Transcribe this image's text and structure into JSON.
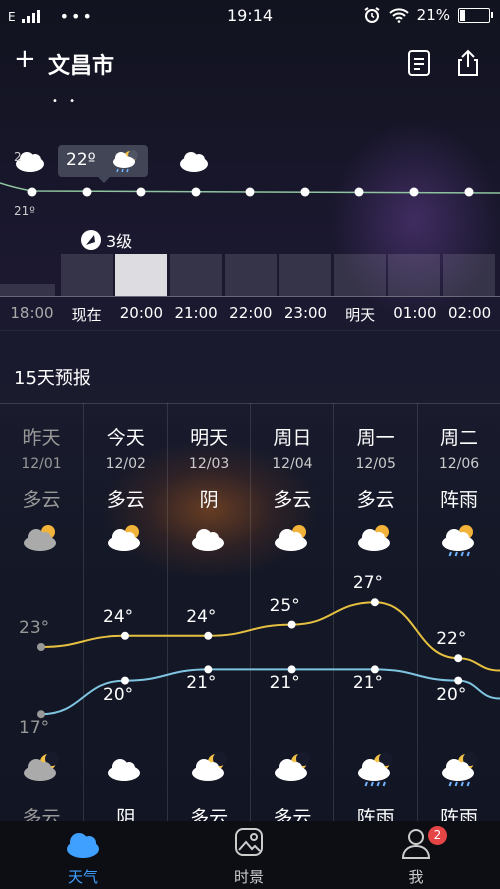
{
  "status": {
    "network": "E",
    "time": "19:14",
    "battery": "21%",
    "battery_level": 0.21
  },
  "header": {
    "add": "+",
    "city": "文昌市",
    "page_dots": "• •"
  },
  "hourly": {
    "tooltip_temp": "22º",
    "left_temp_low": "21º",
    "left_temp_high": "2",
    "wind": "3级",
    "hours": [
      "18:00",
      "现在",
      "20:00",
      "21:00",
      "22:00",
      "23:00",
      "明天",
      "01:00",
      "02:00"
    ]
  },
  "forecast_title": "15天预报",
  "days": [
    {
      "name": "昨天",
      "date": "12/01",
      "day_weather": "多云",
      "night_weather": "多云",
      "high": "23°",
      "low": "17°"
    },
    {
      "name": "今天",
      "date": "12/02",
      "day_weather": "多云",
      "night_weather": "阴",
      "high": "24°",
      "low": "20°"
    },
    {
      "name": "明天",
      "date": "12/03",
      "day_weather": "阴",
      "night_weather": "多云",
      "high": "24°",
      "low": "21°"
    },
    {
      "name": "周日",
      "date": "12/04",
      "day_weather": "多云",
      "night_weather": "多云",
      "high": "25°",
      "low": "21°"
    },
    {
      "name": "周一",
      "date": "12/05",
      "day_weather": "多云",
      "night_weather": "阵雨",
      "high": "27°",
      "low": "21°"
    },
    {
      "name": "周二",
      "date": "12/06",
      "day_weather": "阵雨",
      "night_weather": "阵雨",
      "high": "22°",
      "low": "20°"
    }
  ],
  "tabs": [
    {
      "label": "天气"
    },
    {
      "label": "时景"
    },
    {
      "label": "我",
      "badge": "2"
    }
  ],
  "colors": {
    "accent": "#3fa0ff",
    "high_line": "#e6c040",
    "low_line": "#7fc4e0",
    "badge": "#e64545"
  }
}
